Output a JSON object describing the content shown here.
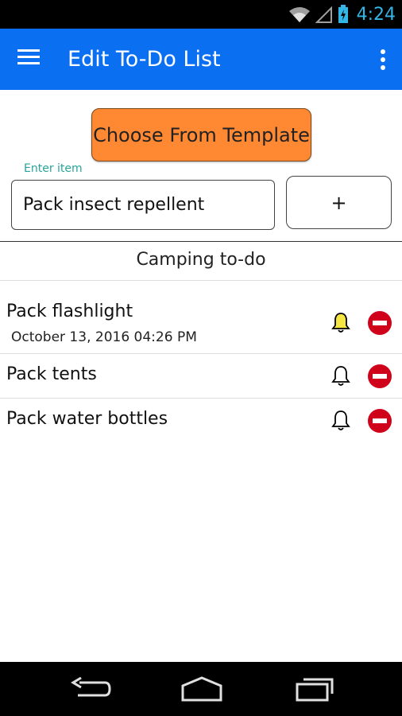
{
  "status_bar": {
    "time": "4:24"
  },
  "app_bar": {
    "title": "Edit To-Do List"
  },
  "actions": {
    "template_button_label": "Choose From Template",
    "add_button_label": "+"
  },
  "entry": {
    "label": "Enter item",
    "value": "Pack insect repellent"
  },
  "list": {
    "title": "Camping to-do",
    "items": [
      {
        "text": "Pack flashlight",
        "date": "October 13, 2016 04:26 PM",
        "reminder_active": true
      },
      {
        "text": "Pack tents",
        "date": "",
        "reminder_active": false
      },
      {
        "text": "Pack water bottles",
        "date": "",
        "reminder_active": false
      }
    ]
  },
  "colors": {
    "app_bar": "#0b6ff2",
    "template_button": "#ff8833",
    "active_bell": "#f5e642",
    "remove_icon": "#d0021b",
    "status_time": "#33b5e5",
    "entry_label": "#26a69a"
  },
  "icons": {
    "menu": "menu-icon",
    "overflow": "overflow-icon",
    "bell": "bell-icon",
    "remove": "remove-icon",
    "back": "back-icon",
    "home": "home-icon",
    "recents": "recents-icon"
  }
}
